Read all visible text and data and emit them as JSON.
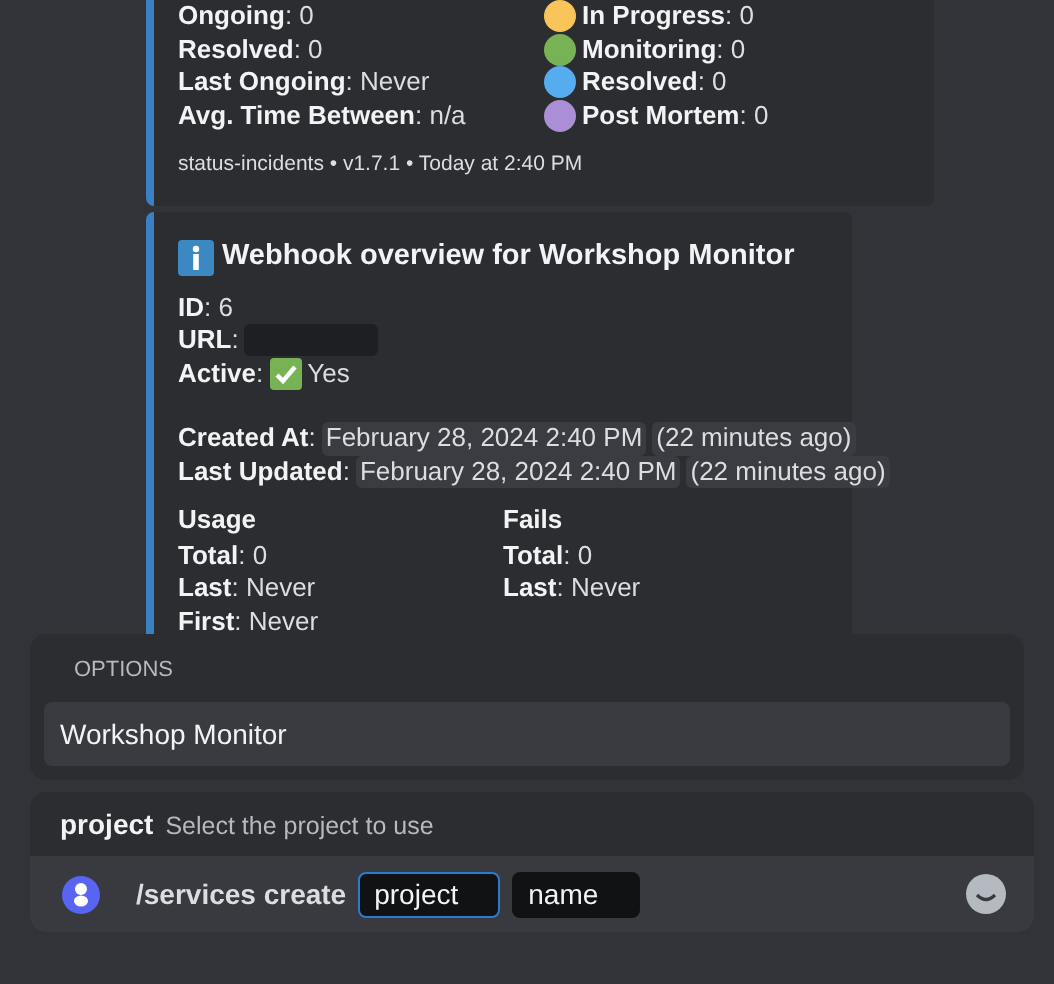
{
  "incident_summary": {
    "stats": [
      "**Ongoing**: 0",
      "**Resolved**: 0",
      "**Last Ongoing**: Never",
      "**Avg. Time Between**: n/a"
    ],
    "statuses": [
      {
        "text": "**In Progress**: 0",
        "color": "#f9c45a"
      },
      {
        "text": "**Monitoring**: 0",
        "color": "#77b255"
      },
      {
        "text": "**Resolved**: 0",
        "color": "#55acee"
      },
      {
        "text": "**Post Mortem**: 0",
        "color": "#aa8ed6"
      }
    ],
    "footer": "status-incidents • v1.7.1 • Today at 2:40 PM"
  },
  "webhook": {
    "title": "Webhook overview for Workshop Monitor",
    "fields": [
      {
        "label": "**ID**: 6",
        "kind": "text"
      },
      {
        "label": "**URL**:",
        "kind": "redacted"
      },
      {
        "label": "**Active**:",
        "value": "Yes",
        "kind": "check"
      }
    ],
    "dates": [
      {
        "label": "**Created At**:",
        "date": "February 28, 2024 2:40 PM",
        "relative": "(22 minutes ago)"
      },
      {
        "label": "**Last Updated**:",
        "date": "February 28, 2024 2:40 PM",
        "relative": "(22 minutes ago)"
      }
    ],
    "columns": [
      {
        "heading": "Usage",
        "rows": [
          "**Total**: 0",
          "**Last**: Never",
          "**First**: Never"
        ]
      },
      {
        "heading": "Fails",
        "rows": [
          "**Total**: 0",
          "**Last**: Never"
        ]
      }
    ]
  },
  "options": {
    "heading": "OPTIONS",
    "items": [
      {
        "label": "Workshop Monitor",
        "selected": true
      }
    ]
  },
  "hint": {
    "name": "project",
    "description": "Select the project to use"
  },
  "command": {
    "text": "/services create",
    "params": [
      {
        "label": "project",
        "selected": true
      },
      {
        "label": "name",
        "selected": false
      }
    ]
  }
}
